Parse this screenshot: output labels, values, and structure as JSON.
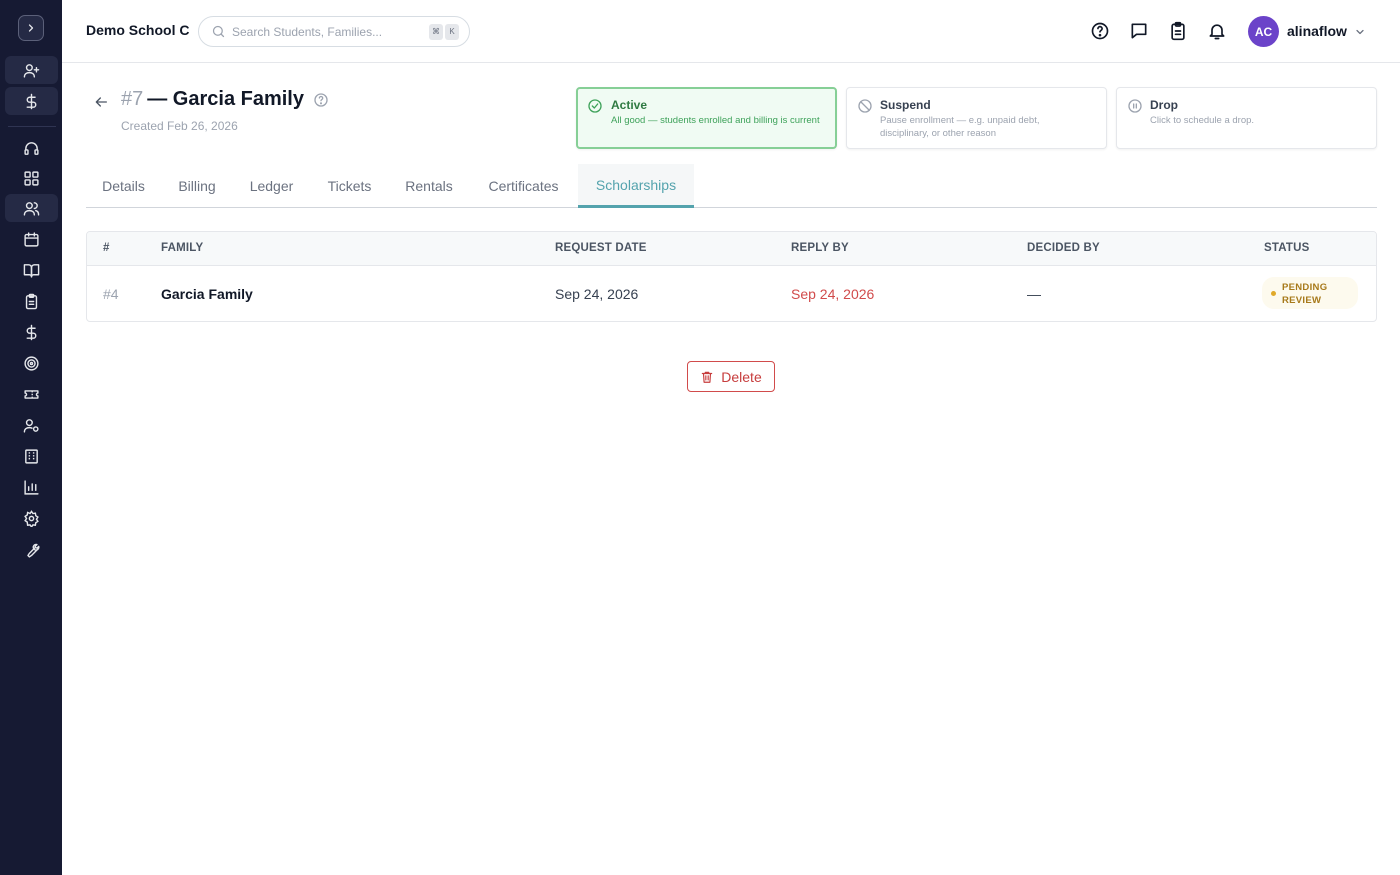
{
  "header": {
    "school": "Demo School C",
    "search_placeholder": "Search Students, Families...",
    "kbd_1": "⌘",
    "kbd_2": "K",
    "avatar_initials": "AC",
    "username": "alinaflow"
  },
  "sidebar": {
    "icons": [
      "user-plus-icon",
      "dollar-icon",
      "headset-icon",
      "dashboard-grid-icon",
      "users-icon",
      "calendar-icon",
      "book-open-icon",
      "clipboard-icon",
      "dollar-icon",
      "target-icon",
      "ticket-icon",
      "user-cog-icon",
      "building-icon",
      "bar-chart-icon",
      "settings-gear-icon",
      "wrench-icon"
    ]
  },
  "page": {
    "number": "#7",
    "title": "— Garcia Family",
    "created": "Created Feb 26, 2026"
  },
  "status_cards": [
    {
      "title": "Active",
      "desc": "All good — students enrolled and billing is current",
      "icon": "check-circle-icon",
      "active": true
    },
    {
      "title": "Suspend",
      "desc": "Pause enrollment — e.g. unpaid debt, disciplinary, or other reason",
      "icon": "ban-icon",
      "active": false
    },
    {
      "title": "Drop",
      "desc": "Click to schedule a drop.",
      "icon": "pause-circle-icon",
      "active": false
    }
  ],
  "tabs": [
    "Details",
    "Billing",
    "Ledger",
    "Tickets",
    "Rentals",
    "Certificates",
    "Scholarships"
  ],
  "active_tab": "Scholarships",
  "table": {
    "columns": [
      "#",
      "FAMILY",
      "REQUEST DATE",
      "REPLY BY",
      "DECIDED BY",
      "STATUS"
    ],
    "rows": [
      {
        "id": "#4",
        "family": "Garcia Family",
        "request_date": "Sep 24, 2026",
        "reply_by": "Sep 24, 2026",
        "decided_by": "—",
        "status": "PENDING REVIEW"
      }
    ]
  },
  "actions": {
    "delete_label": "Delete"
  },
  "colors": {
    "sidebar_bg": "#161a33",
    "accent_teal": "#54a3ad",
    "active_green": "#3ea25a",
    "danger_red": "#d14b4b",
    "avatar_purple": "#6b43c9",
    "badge_amber": "#e0a92a"
  }
}
